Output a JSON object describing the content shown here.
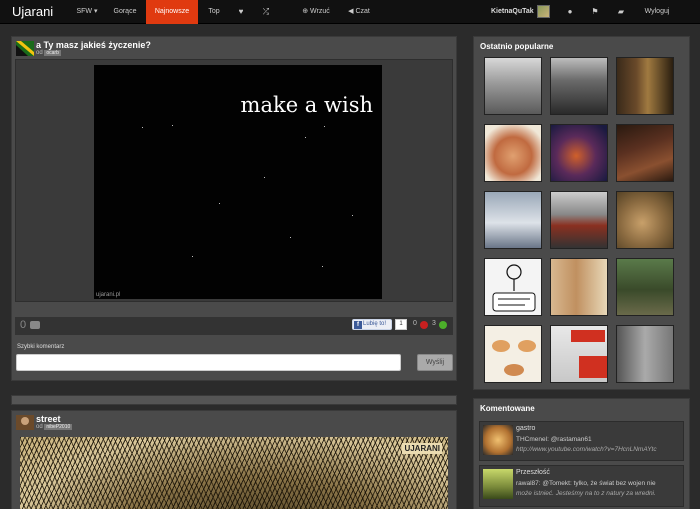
{
  "nav": {
    "brand": "Ujarani",
    "items": [
      {
        "label": "SFW ▾"
      },
      {
        "label": "Gorące"
      },
      {
        "label": "Najnowsze"
      },
      {
        "label": "Top"
      }
    ],
    "upload_label": "Wrzuć",
    "chat_label": "Czat",
    "username": "KietnaQuTak",
    "logout_label": "Wyloguj"
  },
  "posts": [
    {
      "title": "a Ty masz jakieś życzenie?",
      "by_label": "od",
      "user": "ocarb",
      "image_text": "make a wish",
      "watermark": "ujarani.pl",
      "comment_count": "0",
      "fb_like_label": "Lubię to!",
      "fb_count": "1",
      "votes_down": "0",
      "votes_up": "3",
      "quick_comment_label": "Szybki komentarz",
      "send_label": "Wyślij"
    },
    {
      "title": "street",
      "by_label": "od",
      "user": "nibeP2010",
      "watermark": "UJARANI"
    }
  ],
  "sidebar": {
    "popular_title": "Ostatnio popularne",
    "comments_title": "Komentowane",
    "comments": [
      {
        "title": "gastro",
        "user": "THCmenel",
        "mention": "@rastaman61",
        "text": "http://www.youtube.com/watch?v=7HcnLNmAYtc"
      },
      {
        "title": "Przeszłość",
        "user": "rawal87",
        "mention": "@Tomekt:",
        "text": "tylko, że świat bez wojen nie",
        "text2": "może istnieć. Jesteśmy na to z natury za wredni."
      }
    ]
  },
  "colors": {
    "accent": "#e03a10",
    "panel": "#4a4a4a",
    "background": "#2b2b2b"
  }
}
